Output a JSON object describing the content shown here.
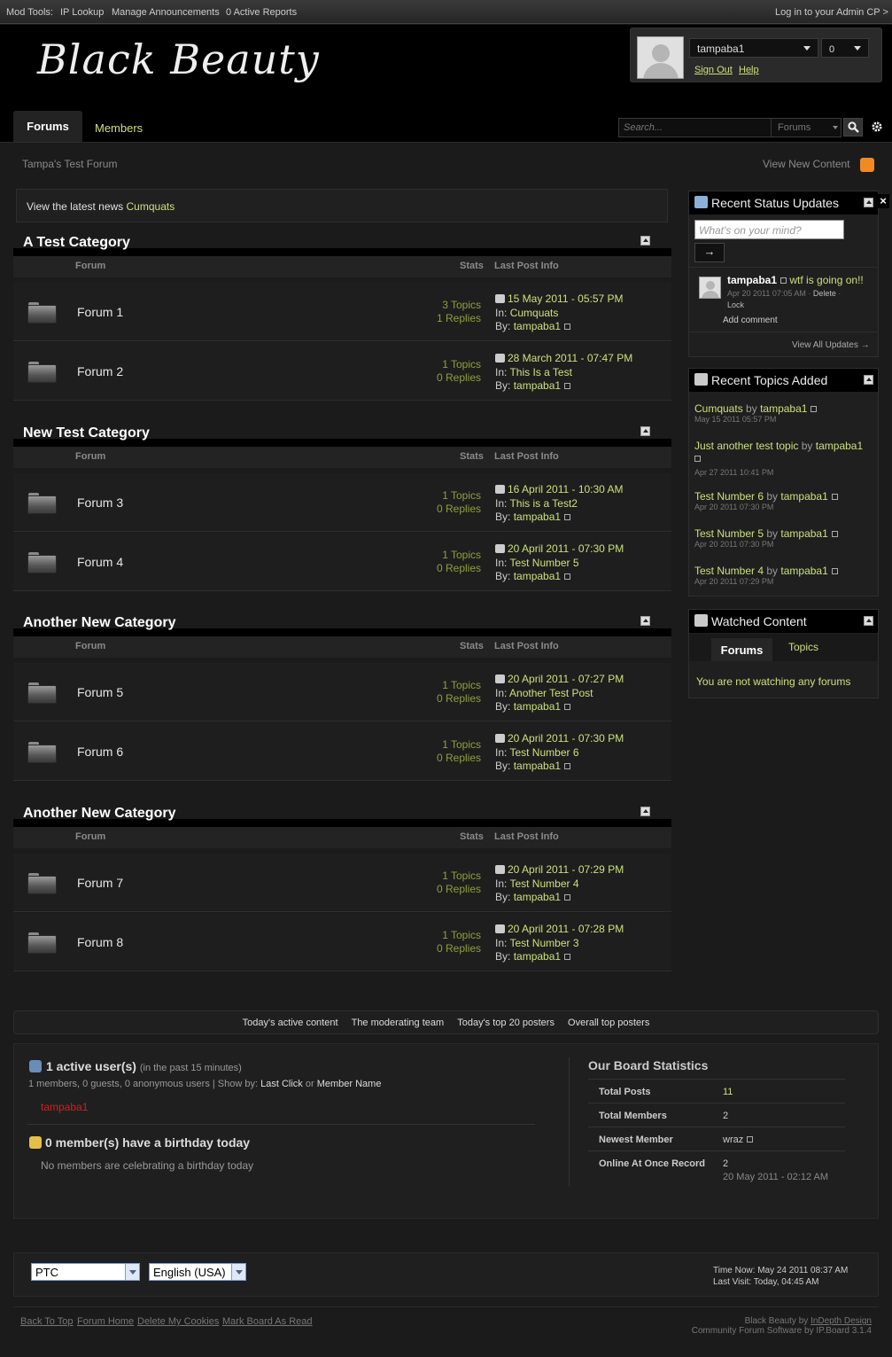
{
  "modbar": {
    "label": "Mod Tools:",
    "ip_lookup": "IP Lookup",
    "manage_announcements": "Manage Announcements",
    "active_reports": "0 Active Reports",
    "admin_cp": "Log in to your Admin CP >"
  },
  "header": {
    "logo": "Black Beauty",
    "username": "tampaba1",
    "notifications": "0",
    "sign_out": "Sign Out",
    "help": "Help"
  },
  "nav": {
    "tab_forums": "Forums",
    "tab_members": "Members",
    "search_placeholder": "Search...",
    "search_scope": "Forums"
  },
  "breadcrumb": "Tampa's Test Forum",
  "view_new_content": "View New Content",
  "news": {
    "prefix": "View the latest news",
    "link": "Cumquats"
  },
  "columns": {
    "forum": "Forum",
    "stats": "Stats",
    "last_post": "Last Post Info"
  },
  "categories": [
    {
      "title": "A Test Category",
      "forums": [
        {
          "name": "Forum 1",
          "topics": "3 Topics",
          "replies": "1 Replies",
          "date": "15 May 2011 - 05:57 PM",
          "in_label": "In:",
          "in": "Cumquats",
          "by_label": "By:",
          "by": "tampaba1"
        },
        {
          "name": "Forum 2",
          "topics": "1 Topics",
          "replies": "0 Replies",
          "date": "28 March 2011 - 07:47 PM",
          "in_label": "In:",
          "in": "This Is a Test",
          "by_label": "By:",
          "by": "tampaba1"
        }
      ]
    },
    {
      "title": "New Test Category",
      "forums": [
        {
          "name": "Forum 3",
          "topics": "1 Topics",
          "replies": "0 Replies",
          "date": "16 April 2011 - 10:30 AM",
          "in_label": "In:",
          "in": "This is a Test2",
          "by_label": "By:",
          "by": "tampaba1"
        },
        {
          "name": "Forum 4",
          "topics": "1 Topics",
          "replies": "0 Replies",
          "date": "20 April 2011 - 07:30 PM",
          "in_label": "In:",
          "in": "Test Number 5",
          "by_label": "By:",
          "by": "tampaba1"
        }
      ]
    },
    {
      "title": "Another New Category",
      "forums": [
        {
          "name": "Forum 5",
          "topics": "1 Topics",
          "replies": "0 Replies",
          "date": "20 April 2011 - 07:27 PM",
          "in_label": "In:",
          "in": "Another Test Post",
          "by_label": "By:",
          "by": "tampaba1"
        },
        {
          "name": "Forum 6",
          "topics": "1 Topics",
          "replies": "0 Replies",
          "date": "20 April 2011 - 07:30 PM",
          "in_label": "In:",
          "in": "Test Number 6",
          "by_label": "By:",
          "by": "tampaba1"
        }
      ]
    },
    {
      "title": "Another New Category",
      "forums": [
        {
          "name": "Forum 7",
          "topics": "1 Topics",
          "replies": "0 Replies",
          "date": "20 April 2011 - 07:29 PM",
          "in_label": "In:",
          "in": "Test Number 4",
          "by_label": "By:",
          "by": "tampaba1"
        },
        {
          "name": "Forum 8",
          "topics": "1 Topics",
          "replies": "0 Replies",
          "date": "20 April 2011 - 07:28 PM",
          "in_label": "In:",
          "in": "Test Number 3",
          "by_label": "By:",
          "by": "tampaba1"
        }
      ]
    }
  ],
  "sidebar": {
    "status": {
      "title": "Recent Status Updates",
      "placeholder": "What's on your mind?",
      "go": "→",
      "user": "tampaba1",
      "text": "wtf is going on!!",
      "meta": "Apr 20 2011 07:05 AM",
      "delete": "Delete",
      "lock": "Lock",
      "add_comment": "Add comment",
      "view_all": "View All Updates →"
    },
    "topics": {
      "title": "Recent Topics Added",
      "by": "by",
      "items": [
        {
          "title": "Cumquats",
          "user": "tampaba1",
          "date": "May 15 2011 05:57 PM"
        },
        {
          "title": "Just another test topic",
          "user": "tampaba1",
          "date": "Apr 27 2011 10:41 PM"
        },
        {
          "title": "Test Number 6",
          "user": "tampaba1",
          "date": "Apr 20 2011 07:30 PM"
        },
        {
          "title": "Test Number 5",
          "user": "tampaba1",
          "date": "Apr 20 2011 07:30 PM"
        },
        {
          "title": "Test Number 4",
          "user": "tampaba1",
          "date": "Apr 20 2011 07:29 PM"
        }
      ]
    },
    "watched": {
      "title": "Watched Content",
      "tab_forums": "Forums",
      "tab_topics": "Topics",
      "empty": "You are not watching any forums"
    }
  },
  "links_bar": [
    "Today's active content",
    "The moderating team",
    "Today's top 20 posters",
    "Overall top posters"
  ],
  "board_stats": {
    "active_title": "1 active user(s)",
    "active_sub": "(in the past 15 minutes)",
    "active_counts": "1 members, 0 guests, 0 anonymous users",
    "show_by": "| Show by:",
    "last_click": "Last Click",
    "or": "or",
    "member_name": "Member Name",
    "active_user": "tampaba1",
    "birthday_title": "0 member(s) have a birthday today",
    "birthday_text": "No members are celebrating a birthday today",
    "stats_title": "Our Board Statistics",
    "total_posts_label": "Total Posts",
    "total_posts": "11",
    "total_members_label": "Total Members",
    "total_members": "2",
    "newest_label": "Newest Member",
    "newest": "wraz",
    "record_label": "Online At Once Record",
    "record": "2",
    "record_date": "20 May 2011 - 02:12 AM"
  },
  "footer": {
    "timezone": "PTC",
    "language": "English (USA)",
    "time_now": "Time Now: May 24 2011 08:37 AM",
    "last_visit": "Last Visit: Today, 04:45 AM",
    "back_to_top": "Back To Top",
    "forum_home": "Forum Home",
    "delete_cookies": "Delete My Cookies",
    "mark_read": "Mark Board As Read",
    "skin_prefix": "Black Beauty by",
    "skin_author": "InDepth Design",
    "software": "Community Forum Software by IP.Board 3.1.4"
  },
  "colors": {
    "accent": "#cde07a",
    "stats": "#8ea03a",
    "member": "#d12020"
  }
}
